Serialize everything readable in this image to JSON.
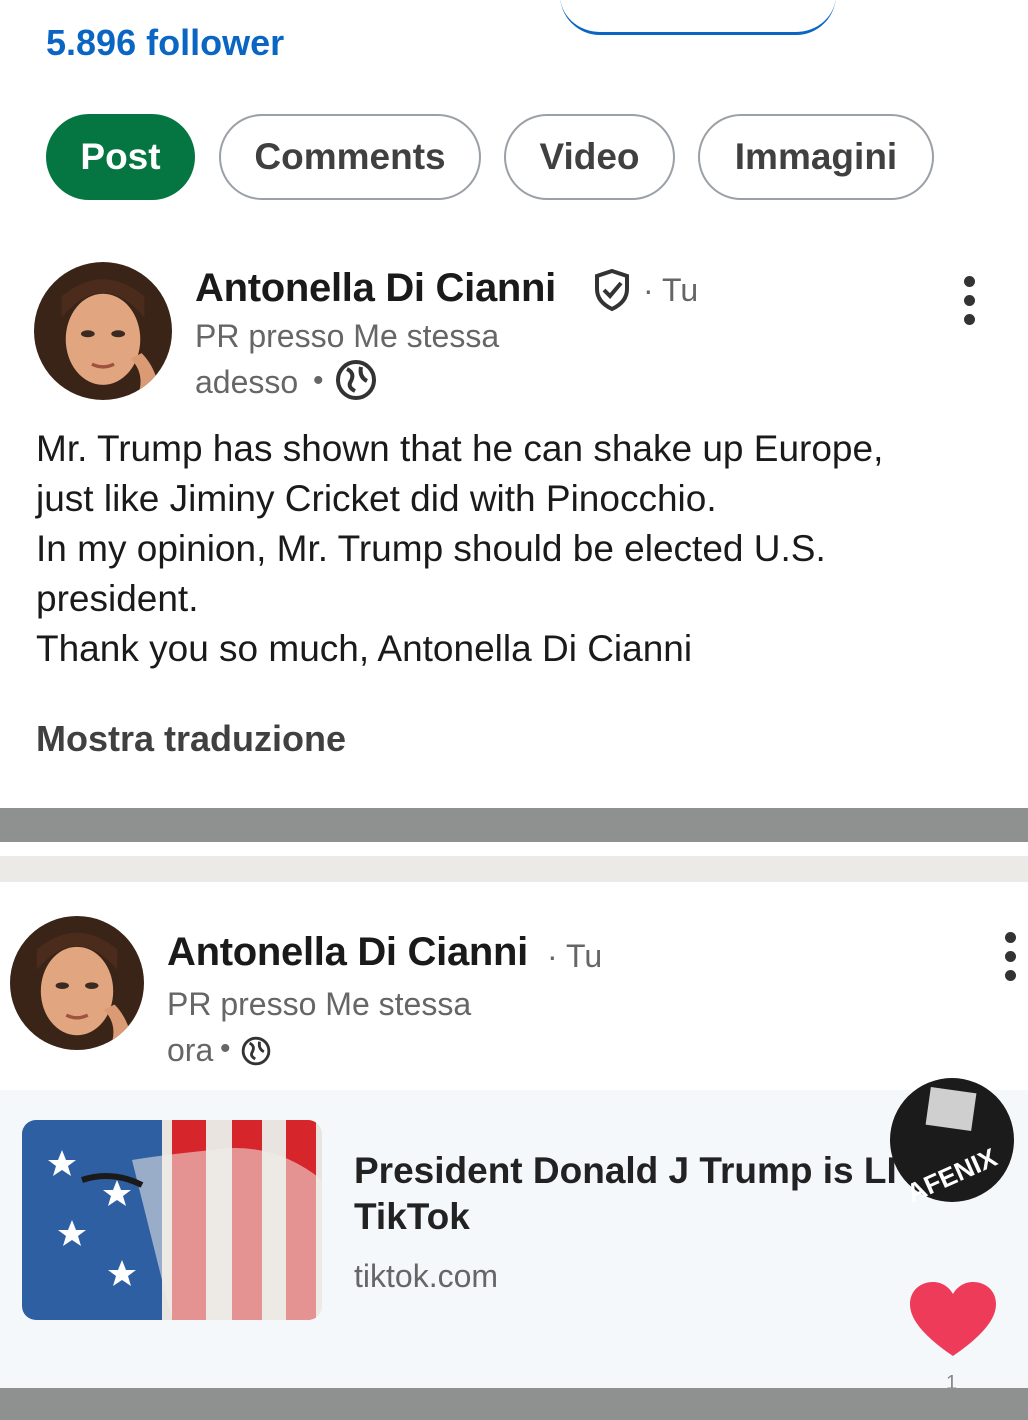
{
  "profile": {
    "followers": "5.896 follower"
  },
  "tabs": [
    {
      "label": "Post",
      "active": true
    },
    {
      "label": "Comments",
      "active": false
    },
    {
      "label": "Video",
      "active": false
    },
    {
      "label": "Immagini",
      "active": false
    }
  ],
  "posts": [
    {
      "author": "Antonella Di Cianni",
      "relation": "· Tu",
      "headline": "PR presso Me stessa",
      "time": "adesso",
      "body": [
        "Mr. Trump has shown that he can shake up Europe,",
        "just like Jiminy Cricket did with Pinocchio.",
        "In my opinion, Mr. Trump should be elected U.S.",
        "president.",
        "Thank you so much, Antonella Di Cianni"
      ],
      "translate": "Mostra traduzione"
    },
    {
      "author": "Antonella Di Cianni",
      "relation": "· Tu",
      "headline": "PR presso Me stessa",
      "time": "ora",
      "link": {
        "title_lines": [
          "President Donald J Trump is LI",
          "TikTok"
        ],
        "domain": "tiktok.com"
      },
      "watermark": "AFENIX",
      "reaction_count": "1"
    }
  ],
  "colors": {
    "accent": "#0a66c2",
    "active_tab": "#057642",
    "heart": "#ef3b5a"
  }
}
